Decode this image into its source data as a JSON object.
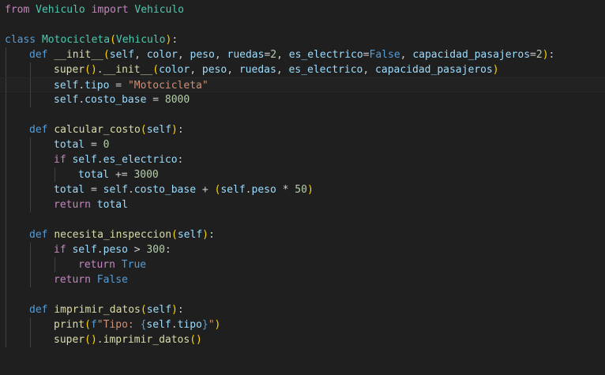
{
  "editor": {
    "language": "python",
    "colors": {
      "background": "#1f1f1f",
      "keyword_control": "#c586c0",
      "keyword": "#569cd6",
      "function": "#dcdcaa",
      "class": "#4ec9b0",
      "variable": "#9cdcfe",
      "string": "#ce9178",
      "number": "#b5cea8",
      "bracket_level1": "#ffd700",
      "bracket_level2": "#da70d6",
      "bracket_level3": "#179fff"
    },
    "lines": [
      {
        "indent": 0,
        "tokens": [
          [
            "kw",
            "from"
          ],
          [
            "plain",
            " "
          ],
          [
            "cls",
            "Vehiculo"
          ],
          [
            "plain",
            " "
          ],
          [
            "kw",
            "import"
          ],
          [
            "plain",
            " "
          ],
          [
            "cls",
            "Vehiculo"
          ]
        ]
      },
      {
        "indent": 0,
        "tokens": []
      },
      {
        "indent": 0,
        "tokens": [
          [
            "def",
            "class"
          ],
          [
            "plain",
            " "
          ],
          [
            "cls",
            "Motocicleta"
          ],
          [
            "brk",
            "("
          ],
          [
            "cls",
            "Vehiculo"
          ],
          [
            "brk",
            ")"
          ],
          [
            "plain",
            ":"
          ]
        ]
      },
      {
        "indent": 1,
        "tokens": [
          [
            "def",
            "def"
          ],
          [
            "plain",
            " "
          ],
          [
            "fn",
            "__init__"
          ],
          [
            "brk",
            "("
          ],
          [
            "var",
            "self"
          ],
          [
            "plain",
            ", "
          ],
          [
            "var",
            "color"
          ],
          [
            "plain",
            ", "
          ],
          [
            "var",
            "peso"
          ],
          [
            "plain",
            ", "
          ],
          [
            "var",
            "ruedas"
          ],
          [
            "plain",
            "="
          ],
          [
            "num",
            "2"
          ],
          [
            "plain",
            ", "
          ],
          [
            "var",
            "es_electrico"
          ],
          [
            "plain",
            "="
          ],
          [
            "def",
            "False"
          ],
          [
            "plain",
            ", "
          ],
          [
            "var",
            "capacidad_pasajeros"
          ],
          [
            "plain",
            "="
          ],
          [
            "num",
            "2"
          ],
          [
            "brk",
            ")"
          ],
          [
            "plain",
            ":"
          ]
        ]
      },
      {
        "indent": 2,
        "tokens": [
          [
            "fn",
            "super"
          ],
          [
            "brk",
            "("
          ],
          [
            "brk",
            ")"
          ],
          [
            "plain",
            "."
          ],
          [
            "fn",
            "__init__"
          ],
          [
            "brk",
            "("
          ],
          [
            "var",
            "color"
          ],
          [
            "plain",
            ", "
          ],
          [
            "var",
            "peso"
          ],
          [
            "plain",
            ", "
          ],
          [
            "var",
            "ruedas"
          ],
          [
            "plain",
            ", "
          ],
          [
            "var",
            "es_electrico"
          ],
          [
            "plain",
            ", "
          ],
          [
            "var",
            "capacidad_pasajeros"
          ],
          [
            "brk",
            ")"
          ]
        ]
      },
      {
        "indent": 2,
        "current": true,
        "tokens": [
          [
            "var",
            "self"
          ],
          [
            "plain",
            "."
          ],
          [
            "var",
            "tipo"
          ],
          [
            "plain",
            " = "
          ],
          [
            "str",
            "\"Motocicleta\""
          ]
        ]
      },
      {
        "indent": 2,
        "tokens": [
          [
            "var",
            "self"
          ],
          [
            "plain",
            "."
          ],
          [
            "var",
            "costo_base"
          ],
          [
            "plain",
            " = "
          ],
          [
            "num",
            "8000"
          ]
        ]
      },
      {
        "indent": 1,
        "tokens": []
      },
      {
        "indent": 1,
        "tokens": [
          [
            "def",
            "def"
          ],
          [
            "plain",
            " "
          ],
          [
            "fn",
            "calcular_costo"
          ],
          [
            "brk",
            "("
          ],
          [
            "var",
            "self"
          ],
          [
            "brk",
            ")"
          ],
          [
            "plain",
            ":"
          ]
        ]
      },
      {
        "indent": 2,
        "tokens": [
          [
            "var",
            "total"
          ],
          [
            "plain",
            " = "
          ],
          [
            "num",
            "0"
          ]
        ]
      },
      {
        "indent": 2,
        "tokens": [
          [
            "kw",
            "if"
          ],
          [
            "plain",
            " "
          ],
          [
            "var",
            "self"
          ],
          [
            "plain",
            "."
          ],
          [
            "var",
            "es_electrico"
          ],
          [
            "plain",
            ":"
          ]
        ]
      },
      {
        "indent": 3,
        "tokens": [
          [
            "var",
            "total"
          ],
          [
            "plain",
            " += "
          ],
          [
            "num",
            "3000"
          ]
        ]
      },
      {
        "indent": 2,
        "tokens": [
          [
            "var",
            "total"
          ],
          [
            "plain",
            " = "
          ],
          [
            "var",
            "self"
          ],
          [
            "plain",
            "."
          ],
          [
            "var",
            "costo_base"
          ],
          [
            "plain",
            " + "
          ],
          [
            "brk",
            "("
          ],
          [
            "var",
            "self"
          ],
          [
            "plain",
            "."
          ],
          [
            "var",
            "peso"
          ],
          [
            "plain",
            " * "
          ],
          [
            "num",
            "50"
          ],
          [
            "brk",
            ")"
          ]
        ]
      },
      {
        "indent": 2,
        "tokens": [
          [
            "kw",
            "return"
          ],
          [
            "plain",
            " "
          ],
          [
            "var",
            "total"
          ]
        ]
      },
      {
        "indent": 1,
        "tokens": []
      },
      {
        "indent": 1,
        "tokens": [
          [
            "def",
            "def"
          ],
          [
            "plain",
            " "
          ],
          [
            "fn",
            "necesita_inspeccion"
          ],
          [
            "brk",
            "("
          ],
          [
            "var",
            "self"
          ],
          [
            "brk",
            ")"
          ],
          [
            "plain",
            ":"
          ]
        ]
      },
      {
        "indent": 2,
        "tokens": [
          [
            "kw",
            "if"
          ],
          [
            "plain",
            " "
          ],
          [
            "var",
            "self"
          ],
          [
            "plain",
            "."
          ],
          [
            "var",
            "peso"
          ],
          [
            "plain",
            " > "
          ],
          [
            "num",
            "300"
          ],
          [
            "plain",
            ":"
          ]
        ]
      },
      {
        "indent": 3,
        "tokens": [
          [
            "kw",
            "return"
          ],
          [
            "plain",
            " "
          ],
          [
            "def",
            "True"
          ]
        ]
      },
      {
        "indent": 2,
        "tokens": [
          [
            "kw",
            "return"
          ],
          [
            "plain",
            " "
          ],
          [
            "def",
            "False"
          ]
        ]
      },
      {
        "indent": 1,
        "tokens": []
      },
      {
        "indent": 1,
        "tokens": [
          [
            "def",
            "def"
          ],
          [
            "plain",
            " "
          ],
          [
            "fn",
            "imprimir_datos"
          ],
          [
            "brk",
            "("
          ],
          [
            "var",
            "self"
          ],
          [
            "brk",
            ")"
          ],
          [
            "plain",
            ":"
          ]
        ]
      },
      {
        "indent": 2,
        "tokens": [
          [
            "fn",
            "print"
          ],
          [
            "brk",
            "("
          ],
          [
            "def",
            "f"
          ],
          [
            "str",
            "\"Tipo: "
          ],
          [
            "def",
            "{"
          ],
          [
            "var",
            "self"
          ],
          [
            "plain",
            "."
          ],
          [
            "var",
            "tipo"
          ],
          [
            "def",
            "}"
          ],
          [
            "str",
            "\""
          ],
          [
            "brk",
            ")"
          ]
        ]
      },
      {
        "indent": 2,
        "tokens": [
          [
            "fn",
            "super"
          ],
          [
            "brk",
            "("
          ],
          [
            "brk",
            ")"
          ],
          [
            "plain",
            "."
          ],
          [
            "fn",
            "imprimir_datos"
          ],
          [
            "brk",
            "("
          ],
          [
            "brk",
            ")"
          ]
        ]
      }
    ]
  }
}
